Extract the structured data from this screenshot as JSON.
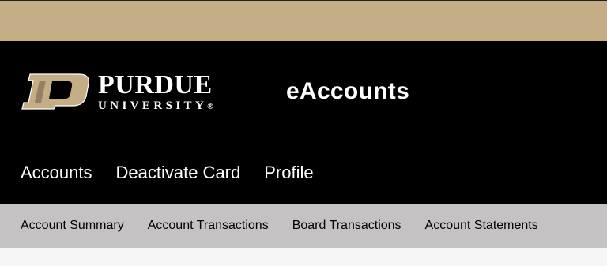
{
  "colors": {
    "topbar": "#c5ad85",
    "header": "#000000",
    "subnav": "#c4c2c2",
    "content": "#f5f5f5",
    "logo_gold": "#c5ad85"
  },
  "logo": {
    "line1": "PURDUE",
    "line2": "UNIVERSITY",
    "mark": "®"
  },
  "app_title": "eAccounts",
  "main_nav": {
    "items": [
      {
        "label": "Accounts"
      },
      {
        "label": "Deactivate Card"
      },
      {
        "label": "Profile"
      }
    ]
  },
  "sub_nav": {
    "items": [
      {
        "label": "Account Summary"
      },
      {
        "label": "Account Transactions"
      },
      {
        "label": "Board Transactions"
      },
      {
        "label": "Account Statements"
      }
    ]
  }
}
